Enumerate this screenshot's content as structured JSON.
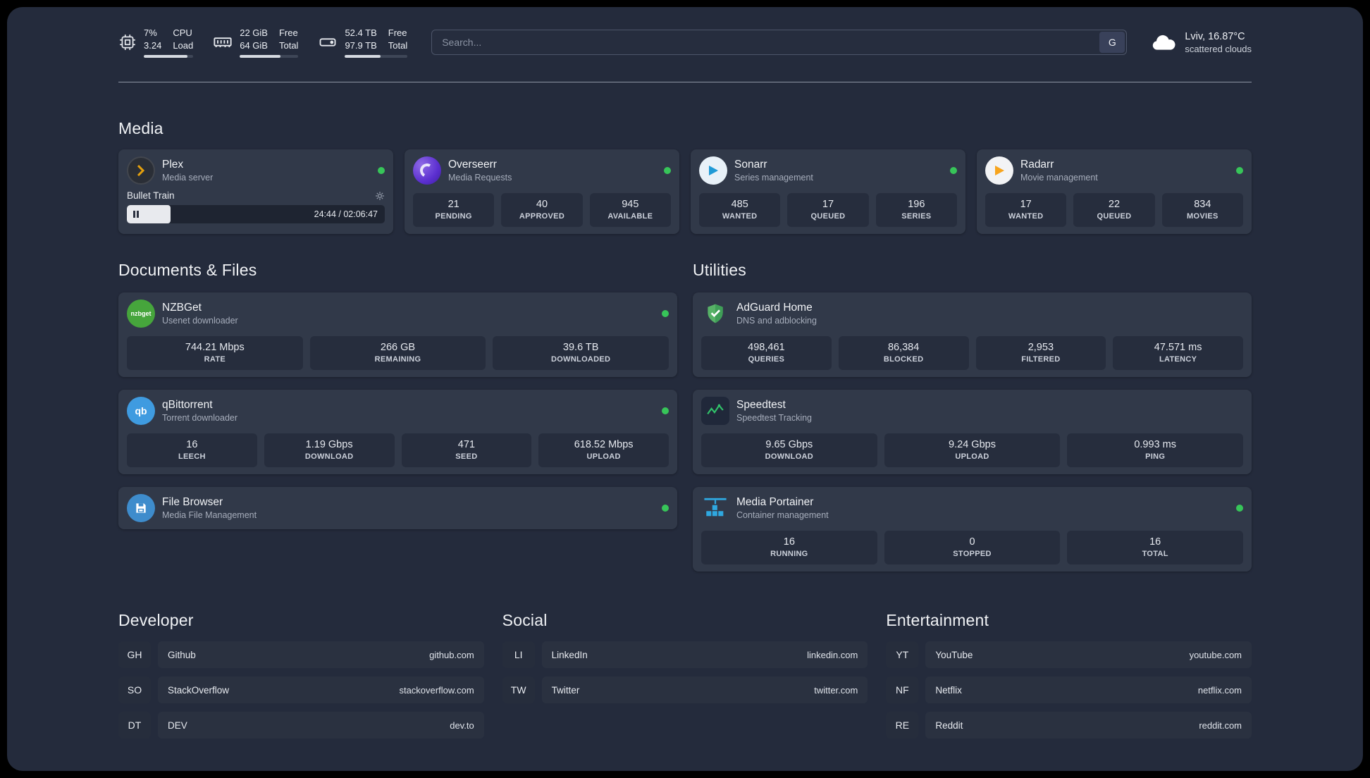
{
  "header": {
    "cpu": {
      "line1": "7%",
      "line2": "3.24",
      "label1": "CPU",
      "label2": "Load",
      "progress": 88
    },
    "ram": {
      "line1": "22 GiB",
      "line2": "64 GiB",
      "label1": "Free",
      "label2": "Total",
      "progress": 70
    },
    "disk": {
      "line1": "52.4 TB",
      "line2": "97.9 TB",
      "label1": "Free",
      "label2": "Total",
      "progress": 57
    },
    "search": {
      "placeholder": "Search...",
      "engine_label": "G"
    },
    "weather": {
      "location": "Lviv, 16.87°C",
      "condition": "scattered clouds"
    }
  },
  "sections": {
    "media": {
      "title": "Media",
      "plex": {
        "name": "Plex",
        "subtitle": "Media server",
        "now_playing": "Bullet Train",
        "time": "24:44 / 02:06:47",
        "progress": 17
      },
      "overseerr": {
        "name": "Overseerr",
        "subtitle": "Media Requests",
        "stats": [
          {
            "value": "21",
            "label": "PENDING"
          },
          {
            "value": "40",
            "label": "APPROVED"
          },
          {
            "value": "945",
            "label": "AVAILABLE"
          }
        ]
      },
      "sonarr": {
        "name": "Sonarr",
        "subtitle": "Series management",
        "stats": [
          {
            "value": "485",
            "label": "WANTED"
          },
          {
            "value": "17",
            "label": "QUEUED"
          },
          {
            "value": "196",
            "label": "SERIES"
          }
        ]
      },
      "radarr": {
        "name": "Radarr",
        "subtitle": "Movie management",
        "stats": [
          {
            "value": "17",
            "label": "WANTED"
          },
          {
            "value": "22",
            "label": "QUEUED"
          },
          {
            "value": "834",
            "label": "MOVIES"
          }
        ]
      }
    },
    "documents": {
      "title": "Documents & Files",
      "nzbget": {
        "name": "NZBGet",
        "subtitle": "Usenet downloader",
        "icon_text": "nzbget",
        "stats": [
          {
            "value": "744.21 Mbps",
            "label": "RATE"
          },
          {
            "value": "266 GB",
            "label": "REMAINING"
          },
          {
            "value": "39.6 TB",
            "label": "DOWNLOADED"
          }
        ]
      },
      "qbittorrent": {
        "name": "qBittorrent",
        "subtitle": "Torrent downloader",
        "icon_text": "qb",
        "stats": [
          {
            "value": "16",
            "label": "LEECH"
          },
          {
            "value": "1.19 Gbps",
            "label": "DOWNLOAD"
          },
          {
            "value": "471",
            "label": "SEED"
          },
          {
            "value": "618.52 Mbps",
            "label": "UPLOAD"
          }
        ]
      },
      "filebrowser": {
        "name": "File Browser",
        "subtitle": "Media File Management"
      }
    },
    "utilities": {
      "title": "Utilities",
      "adguard": {
        "name": "AdGuard Home",
        "subtitle": "DNS and adblocking",
        "stats": [
          {
            "value": "498,461",
            "label": "QUERIES"
          },
          {
            "value": "86,384",
            "label": "BLOCKED"
          },
          {
            "value": "2,953",
            "label": "FILTERED"
          },
          {
            "value": "47.571 ms",
            "label": "LATENCY"
          }
        ]
      },
      "speedtest": {
        "name": "Speedtest",
        "subtitle": "Speedtest Tracking",
        "stats": [
          {
            "value": "9.65 Gbps",
            "label": "DOWNLOAD"
          },
          {
            "value": "9.24 Gbps",
            "label": "UPLOAD"
          },
          {
            "value": "0.993 ms",
            "label": "PING"
          }
        ]
      },
      "portainer": {
        "name": "Media Portainer",
        "subtitle": "Container management",
        "stats": [
          {
            "value": "16",
            "label": "RUNNING"
          },
          {
            "value": "0",
            "label": "STOPPED"
          },
          {
            "value": "16",
            "label": "TOTAL"
          }
        ]
      }
    }
  },
  "bookmarks": {
    "developer": {
      "title": "Developer",
      "items": [
        {
          "abbr": "GH",
          "name": "Github",
          "url": "github.com"
        },
        {
          "abbr": "SO",
          "name": "StackOverflow",
          "url": "stackoverflow.com"
        },
        {
          "abbr": "DT",
          "name": "DEV",
          "url": "dev.to"
        }
      ]
    },
    "social": {
      "title": "Social",
      "items": [
        {
          "abbr": "LI",
          "name": "LinkedIn",
          "url": "linkedin.com"
        },
        {
          "abbr": "TW",
          "name": "Twitter",
          "url": "twitter.com"
        }
      ]
    },
    "entertainment": {
      "title": "Entertainment",
      "items": [
        {
          "abbr": "YT",
          "name": "YouTube",
          "url": "youtube.com"
        },
        {
          "abbr": "NF",
          "name": "Netflix",
          "url": "netflix.com"
        },
        {
          "abbr": "RE",
          "name": "Reddit",
          "url": "reddit.com"
        }
      ]
    }
  }
}
